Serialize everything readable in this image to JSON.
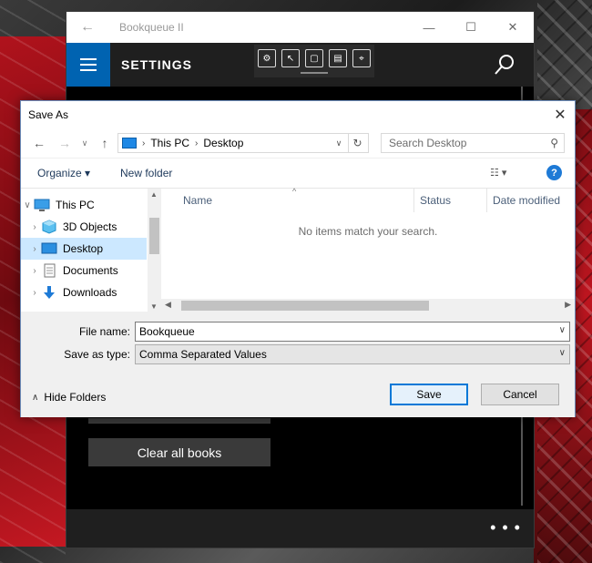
{
  "app": {
    "title": "Bookqueue II",
    "header_title": "SETTINGS",
    "clear_all_label": "Clear all books",
    "more_label": "• • •"
  },
  "dialog": {
    "title": "Save As",
    "address": {
      "root": "This PC",
      "current": "Desktop"
    },
    "search_placeholder": "Search Desktop",
    "toolbar": {
      "organize": "Organize ▾",
      "new_folder": "New folder"
    },
    "nav_tree": [
      {
        "label": "This PC"
      },
      {
        "label": "3D Objects"
      },
      {
        "label": "Desktop"
      },
      {
        "label": "Documents"
      },
      {
        "label": "Downloads"
      }
    ],
    "columns": {
      "name": "Name",
      "status": "Status",
      "date_modified": "Date modified"
    },
    "empty_message": "No items match your search.",
    "file_name_label": "File name:",
    "file_name_value": "Bookqueue",
    "save_type_label": "Save as type:",
    "save_type_value": "Comma Separated Values",
    "hide_folders_label": "Hide Folders",
    "save_label": "Save",
    "cancel_label": "Cancel"
  },
  "colors": {
    "accent": "#0063b1",
    "selection": "#cce8ff",
    "primary_button_border": "#0078d7"
  }
}
